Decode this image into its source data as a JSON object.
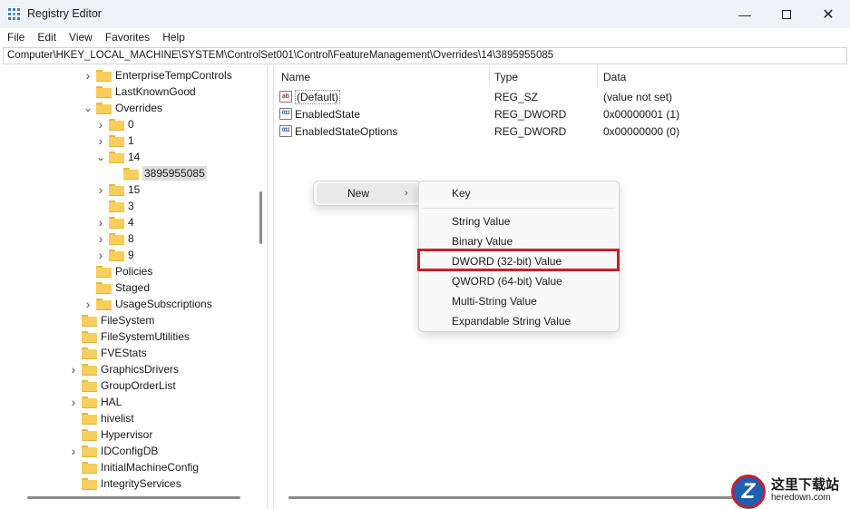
{
  "window": {
    "title": "Registry Editor",
    "controls": [
      "minimize-icon",
      "maximize-icon",
      "close-icon"
    ]
  },
  "menubar": {
    "items": [
      "File",
      "Edit",
      "View",
      "Favorites",
      "Help"
    ]
  },
  "address": {
    "path": "Computer\\HKEY_LOCAL_MACHINE\\SYSTEM\\ControlSet001\\Control\\FeatureManagement\\Overrides\\14\\3895955085"
  },
  "tree": {
    "items": [
      {
        "label": "EnterpriseTempControls",
        "chevron": "right"
      },
      {
        "label": "LastKnownGood",
        "chevron": ""
      },
      {
        "label": "Overrides",
        "chevron": "down"
      },
      {
        "label": "0",
        "chevron": "right"
      },
      {
        "label": "1",
        "chevron": "right"
      },
      {
        "label": "14",
        "chevron": "down"
      },
      {
        "label": "3895955085",
        "chevron": ""
      },
      {
        "label": "15",
        "chevron": "right"
      },
      {
        "label": "3",
        "chevron": ""
      },
      {
        "label": "4",
        "chevron": "right"
      },
      {
        "label": "8",
        "chevron": "right"
      },
      {
        "label": "9",
        "chevron": "right"
      },
      {
        "label": "Policies",
        "chevron": ""
      },
      {
        "label": "Staged",
        "chevron": ""
      },
      {
        "label": "UsageSubscriptions",
        "chevron": "right"
      },
      {
        "label": "FileSystem",
        "chevron": ""
      },
      {
        "label": "FileSystemUtilities",
        "chevron": ""
      },
      {
        "label": "FVEStats",
        "chevron": ""
      },
      {
        "label": "GraphicsDrivers",
        "chevron": "right"
      },
      {
        "label": "GroupOrderList",
        "chevron": ""
      },
      {
        "label": "HAL",
        "chevron": "right"
      },
      {
        "label": "hivelist",
        "chevron": ""
      },
      {
        "label": "Hypervisor",
        "chevron": ""
      },
      {
        "label": "IDConfigDB",
        "chevron": "right"
      },
      {
        "label": "InitialMachineConfig",
        "chevron": ""
      },
      {
        "label": "IntegrityServices",
        "chevron": ""
      }
    ],
    "selected": "3895955085"
  },
  "list": {
    "columns": [
      "Name",
      "Type",
      "Data"
    ],
    "rows": [
      {
        "name": "(Default)",
        "type": "REG_SZ",
        "data": "(value not set)",
        "icon": "string-value-icon"
      },
      {
        "name": "EnabledState",
        "type": "REG_DWORD",
        "data": "0x00000001 (1)",
        "icon": "binary-value-icon"
      },
      {
        "name": "EnabledStateOptions",
        "type": "REG_DWORD",
        "data": "0x00000000 (0)",
        "icon": "binary-value-icon"
      }
    ]
  },
  "context_menu": {
    "new_label": "New",
    "submenu": [
      "Key",
      "String Value",
      "Binary Value",
      "DWORD (32-bit) Value",
      "QWORD (64-bit) Value",
      "Multi-String Value",
      "Expandable String Value"
    ],
    "highlighted": "DWORD (32-bit) Value"
  },
  "watermark": {
    "logo_letter": "Z",
    "cn_text": "这里下载站",
    "en_text": "heredown.com"
  },
  "colors": {
    "titlebar": "#eef3f8",
    "folder": "#f7cf5a",
    "highlight_border": "#c8202a"
  }
}
